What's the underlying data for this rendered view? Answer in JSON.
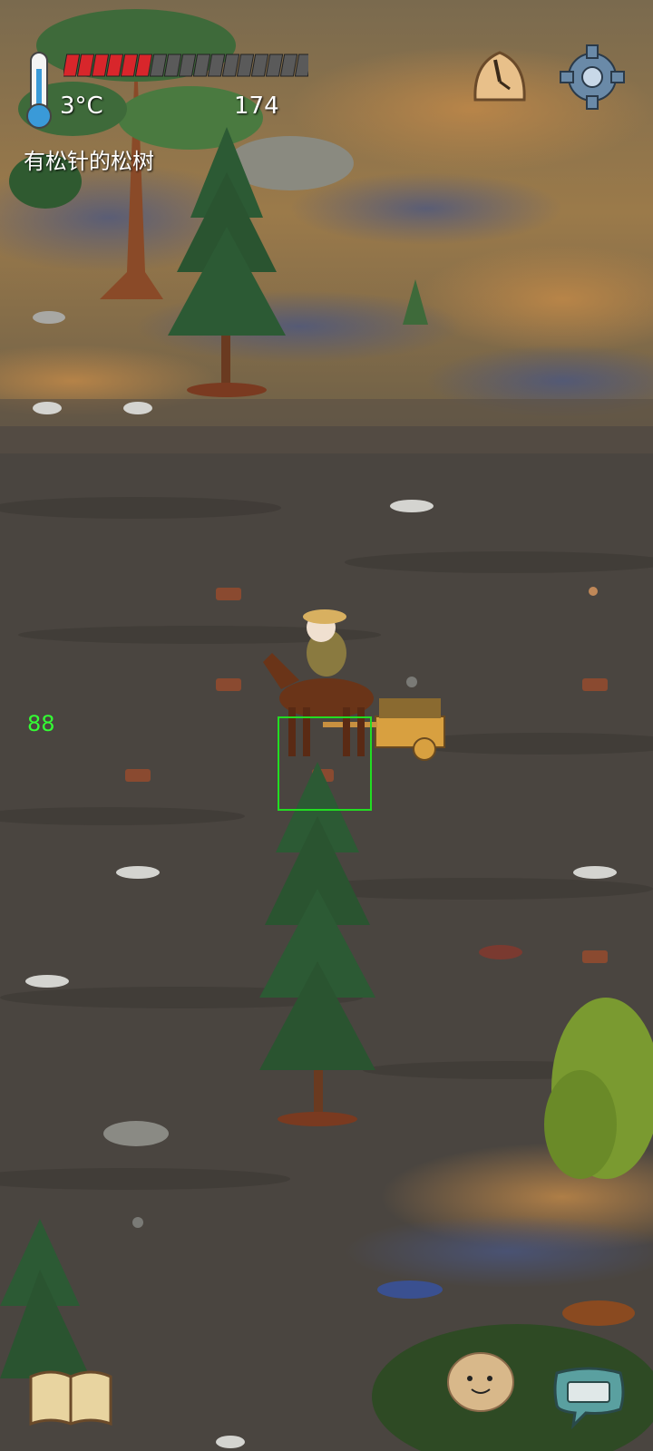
{
  "hud": {
    "temperature": "3°C",
    "score": "174",
    "hover_object": "有松针的松树",
    "food_pips_total": 17,
    "food_pips_filled": 6,
    "yum_counter": "88"
  },
  "icons": {
    "thermometer": "thermometer-icon",
    "clock": "clock-icon",
    "settings": "gear-icon",
    "recipe_book": "book-icon",
    "emote": "potato-face-icon",
    "chat": "keyboard-icon"
  },
  "colors": {
    "food_fill": "#d8262b",
    "food_empty": "#5a5a5a",
    "selection": "#22dd22",
    "yum_text": "#33ff33",
    "ground": "#4a4540",
    "tree": "#2c5a34"
  }
}
